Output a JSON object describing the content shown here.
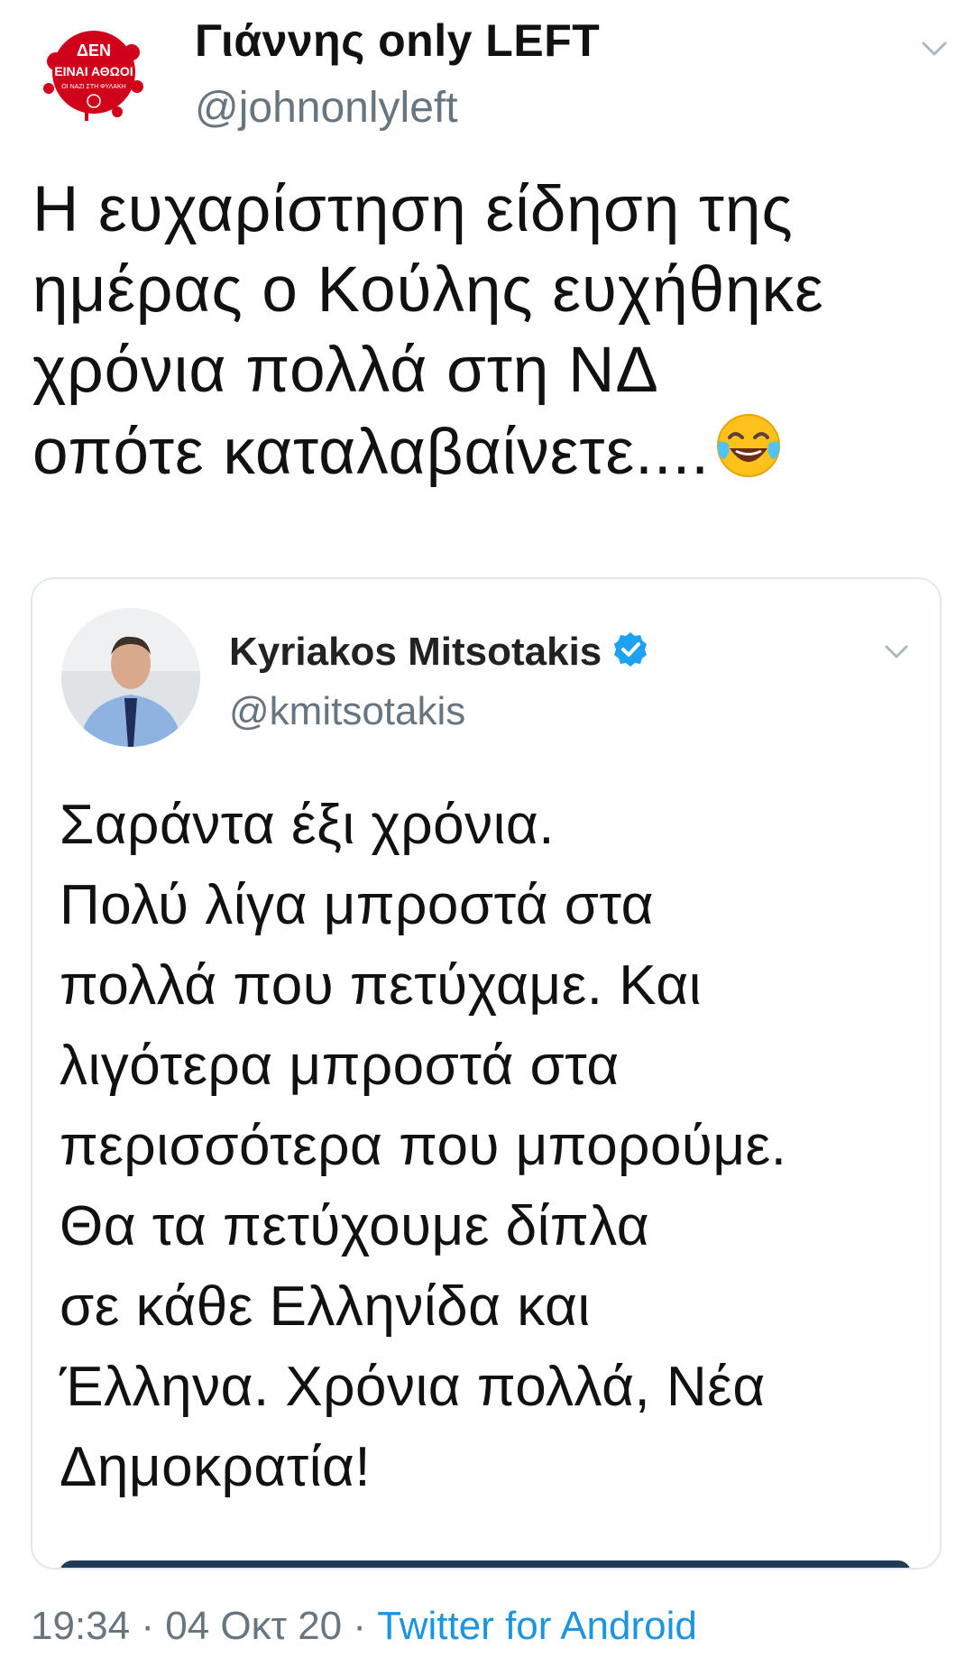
{
  "author": {
    "display_name": "Γιάννης only LEFT",
    "handle": "@johnonlyleft",
    "avatar_text": "ΔΕΝ ΕΙΝΑΙ ΑΘΩΟΙ",
    "avatar_icon": "protest-avatar"
  },
  "tweet": {
    "lines": [
      "Η ευχαρίστηση είδηση της",
      "ημέρας ο Κούλης ευχήθηκε",
      "χρόνια πολλά στη ΝΔ",
      "οπότε καταλαβαίνετε...."
    ],
    "emoji": "face-with-tears-of-joy"
  },
  "quoted": {
    "display_name": "Kyriakos Mitsotakis",
    "handle": "@kmitsotakis",
    "verified": true,
    "lines": [
      "Σαράντα έξι χρόνια.",
      "Πολύ λίγα μπροστά στα",
      "πολλά που πετύχαμε. Και",
      "λιγότερα μπροστά στα",
      "περισσότερα που μπορούμε.",
      "Θα τα πετύχουμε δίπλα",
      "σε κάθε Ελληνίδα  και",
      "Έλληνα. Χρόνια πολλά, Νέα",
      "Δημοκρατία!"
    ]
  },
  "meta": {
    "time": "19:34",
    "sep1": " · ",
    "date": "04 Οκτ 20",
    "sep2": " · ",
    "source": "Twitter for Android"
  },
  "colors": {
    "link": "#1b95e0",
    "secondary_text": "#66757f",
    "border": "#e1e8ed",
    "verified": "#1da1f2"
  }
}
